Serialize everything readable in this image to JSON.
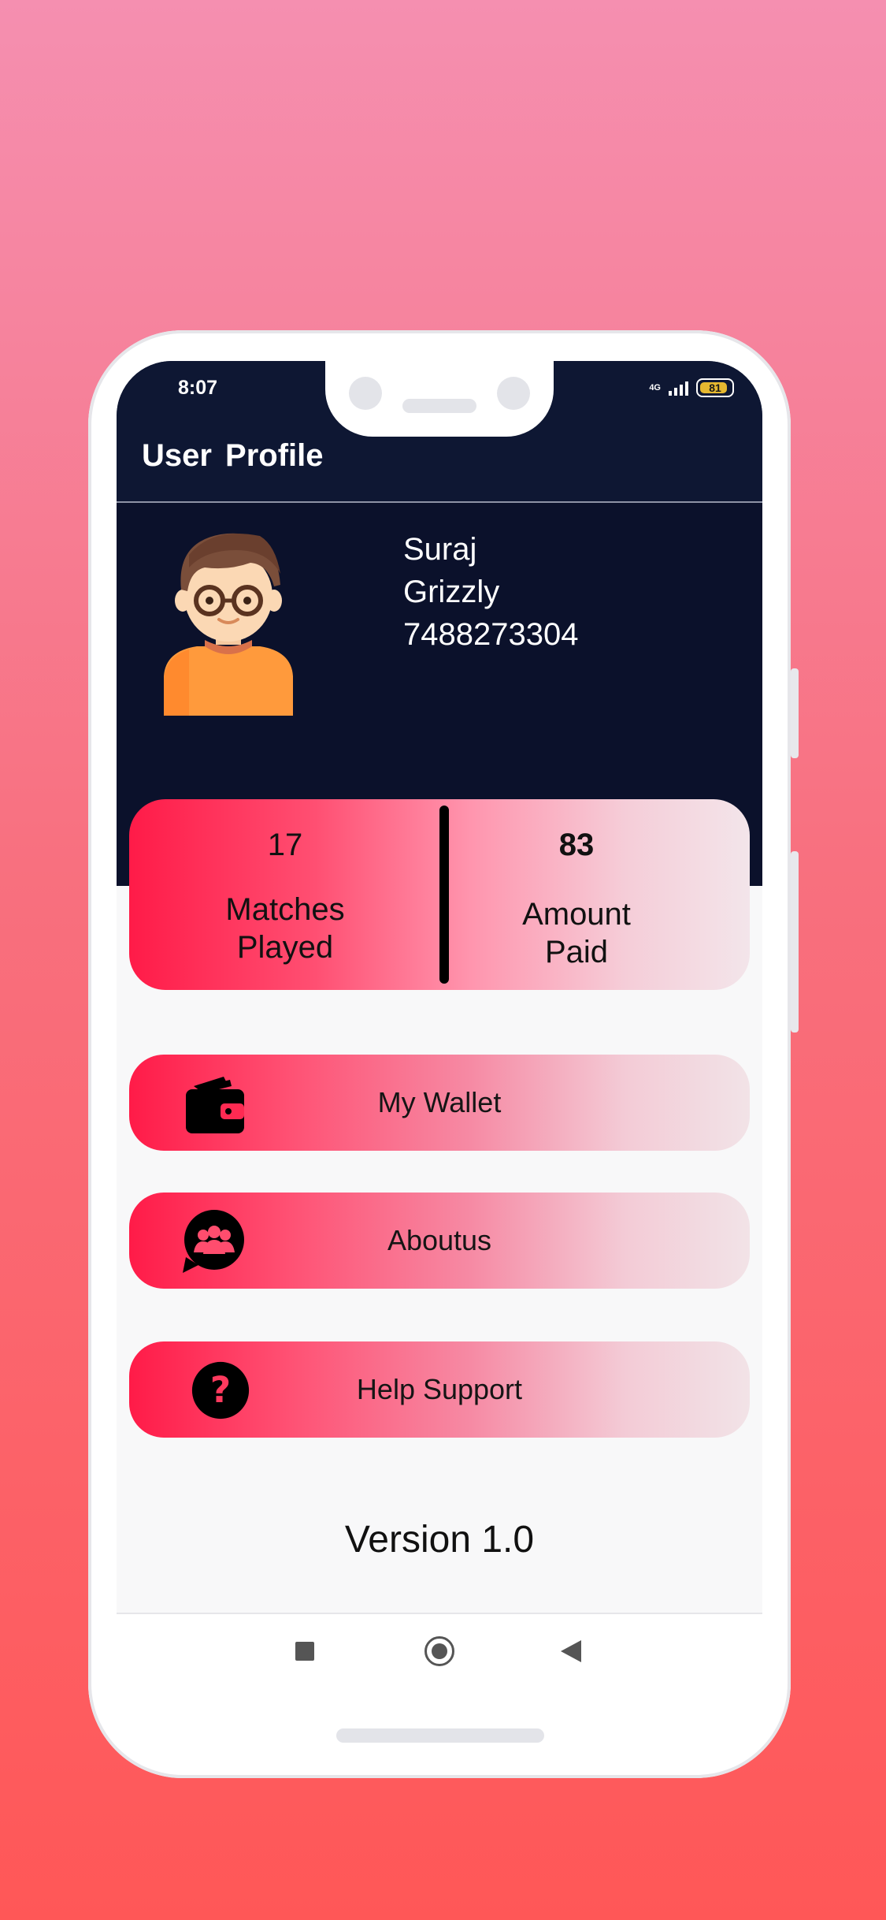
{
  "status_bar": {
    "time": "8:07",
    "network": "4G",
    "battery": "81"
  },
  "app_bar": {
    "title": "User  Profile"
  },
  "profile": {
    "first_name": "Suraj",
    "last_name": "Grizzly",
    "phone": "7488273304",
    "avatar_icon": "boy-with-glasses-avatar"
  },
  "stats": {
    "matches": {
      "value": "17",
      "label_line1": "Matches",
      "label_line2": "Played"
    },
    "amount": {
      "value": "83",
      "label_line1": "Amount",
      "label_line2": "Paid"
    }
  },
  "menu": [
    {
      "label": "My Wallet",
      "icon": "wallet-icon"
    },
    {
      "label": "Aboutus",
      "icon": "group-chat-icon"
    },
    {
      "label": "Help Support",
      "icon": "help-icon"
    }
  ],
  "footer": {
    "version": "Version 1.0"
  },
  "colors": {
    "appbar": "#0e1733",
    "header_bg": "#0b112b",
    "accent_pink": "#ff1b48",
    "card_fade": "#f3e5ea"
  }
}
